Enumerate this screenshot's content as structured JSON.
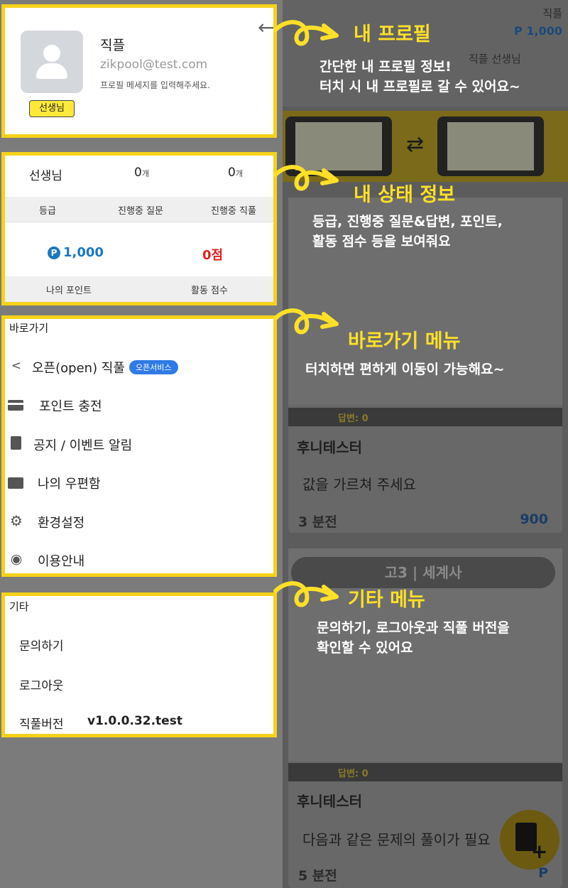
{
  "background_app": {
    "top_name": "직플",
    "top_points": "P 1,000",
    "sub_title": "직플 선생님",
    "card1": {
      "answer_label": "답변: 0",
      "author": "후니테스터",
      "question": "값을 가르쳐 주세요",
      "time": "3 분전",
      "points": "900"
    },
    "tag": "고3 | 세계사",
    "card2": {
      "answer_label": "답변: 0",
      "author": "후니테스터",
      "question": "다음과 같은 문제의 풀이가 필요",
      "time": "5 분전",
      "points": "P"
    }
  },
  "profile": {
    "name": "직플",
    "email": "zikpool@test.com",
    "message": "프로필 메세지를 입력해주세요.",
    "role": "선생님"
  },
  "status": {
    "role": "선생님",
    "questions_count": "0",
    "answers_count": "0",
    "count_unit": "개",
    "grade_label": "등급",
    "questions_label": "진행중 질문",
    "answers_label": "진행중 직풀",
    "points_value": "1,000",
    "points_symbol": "P",
    "score_value": "0점",
    "points_label": "나의 포인트",
    "score_label": "활동 점수"
  },
  "shortcuts": {
    "title": "바로가기",
    "items": [
      {
        "label": "오픈(open) 직풀",
        "badge": "오픈서비스"
      },
      {
        "label": "포인트 충전"
      },
      {
        "label": "공지 / 이벤트 알림"
      },
      {
        "label": "나의 우편함"
      },
      {
        "label": "환경설정"
      },
      {
        "label": "이용안내"
      }
    ]
  },
  "etc": {
    "title": "기타",
    "inquiry": "문의하기",
    "logout": "로그아웃",
    "version_label": "직풀버전",
    "version_value": "v1.0.0.32.test"
  },
  "tutorial": {
    "profile_title": "내 프로필",
    "profile_desc_1": "간단한 내 프로필 정보!",
    "profile_desc_2": "터치 시 내 프로필로 갈 수 있어요~",
    "status_title": "내 상태 정보",
    "status_desc_1": "등급, 진행중 질문&답변, 포인트,",
    "status_desc_2": "활동 점수 등을 보여줘요",
    "shortcut_title": "바로가기 메뉴",
    "shortcut_desc": "터치하면 편하게 이동이 가능해요~",
    "etc_title": "기타 메뉴",
    "etc_desc_1": "문의하기, 로그아웃과 직풀 버전을",
    "etc_desc_2": "확인할 수 있어요"
  },
  "colors": {
    "highlight": "#f5d21a",
    "callout_text": "#fde027",
    "points": "#1a78c2",
    "score": "#e02020",
    "badge": "#2f7ae5"
  }
}
